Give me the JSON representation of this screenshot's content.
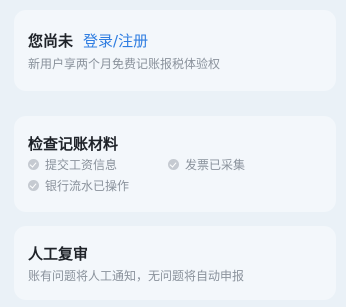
{
  "login_card": {
    "title": "您尚未",
    "login_link": "登录/注册",
    "subtitle": "新用户享两个月免费记账报税体验权"
  },
  "check_card": {
    "title": "检查记账材料",
    "items": [
      {
        "label": "提交工资信息",
        "icon": "check-circle-icon"
      },
      {
        "label": "发票已采集",
        "icon": "check-circle-icon"
      },
      {
        "label": "银行流水已操作",
        "icon": "check-circle-icon"
      }
    ]
  },
  "review_card": {
    "title": "人工复审",
    "subtitle": "账有问题将人工通知，无问题将自动申报"
  },
  "colors": {
    "background": "#eaf1f7",
    "card": "#f3f7fb",
    "link": "#2f7de1",
    "title": "#1f2329",
    "muted": "#8a929c"
  }
}
